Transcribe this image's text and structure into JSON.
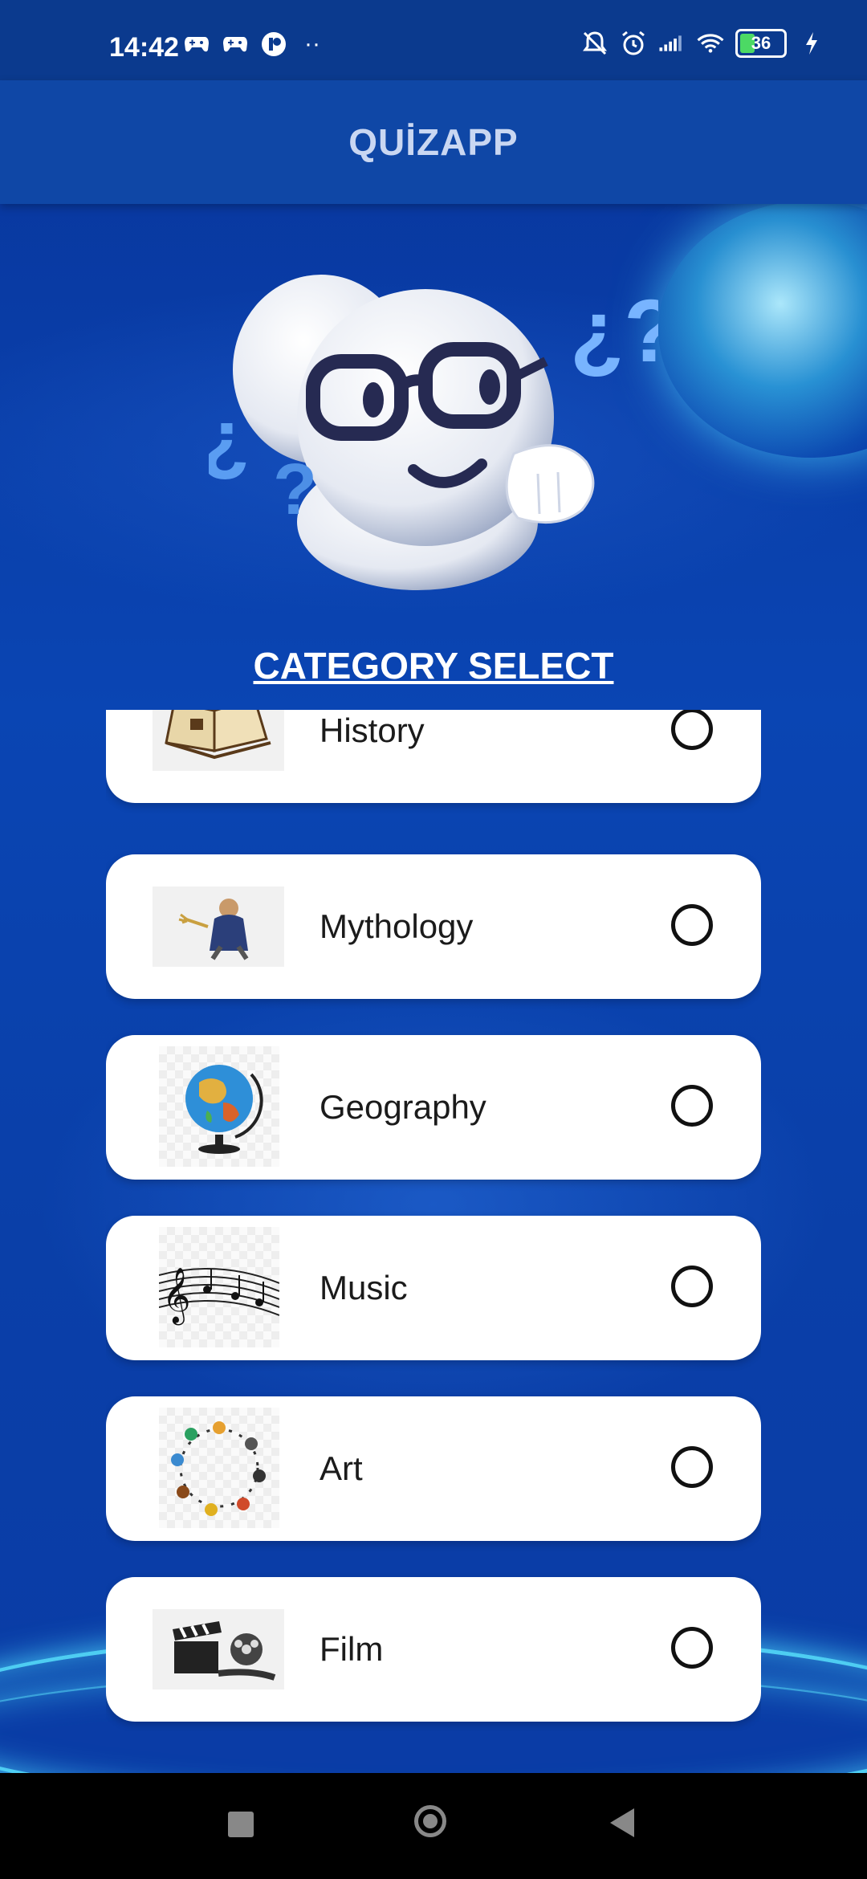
{
  "status_bar": {
    "time": "14:42",
    "battery_level": "36",
    "left_icons": [
      "game-controller-icon",
      "game-controller-icon",
      "app-notification-icon",
      "more-dots-icon"
    ],
    "right_icons": [
      "mute-bell-icon",
      "alarm-icon",
      "signal-icon",
      "wifi-icon",
      "battery-icon",
      "charging-icon"
    ]
  },
  "app_bar": {
    "title": "QUİZAPP"
  },
  "mascot": {
    "icon": "thinking-mascot-with-glasses"
  },
  "section": {
    "title": "CATEGORY SELECT"
  },
  "categories": [
    {
      "label": "History",
      "icon": "open-book-icon",
      "selected": false
    },
    {
      "label": "Mythology",
      "icon": "poseidon-icon",
      "selected": false
    },
    {
      "label": "Geography",
      "icon": "globe-icon",
      "selected": false
    },
    {
      "label": "Music",
      "icon": "music-notes-icon",
      "selected": false
    },
    {
      "label": "Art",
      "icon": "art-tools-circle-icon",
      "selected": false
    },
    {
      "label": "Film",
      "icon": "film-clapper-icon",
      "selected": false
    }
  ],
  "nav_bar": {
    "icons": [
      "recents-square-icon",
      "home-circle-icon",
      "back-triangle-icon"
    ]
  },
  "colors": {
    "background": "#0a3fa8",
    "app_bar": "#0f47a6",
    "card": "#ffffff",
    "title_text": "#c9d7f2"
  }
}
